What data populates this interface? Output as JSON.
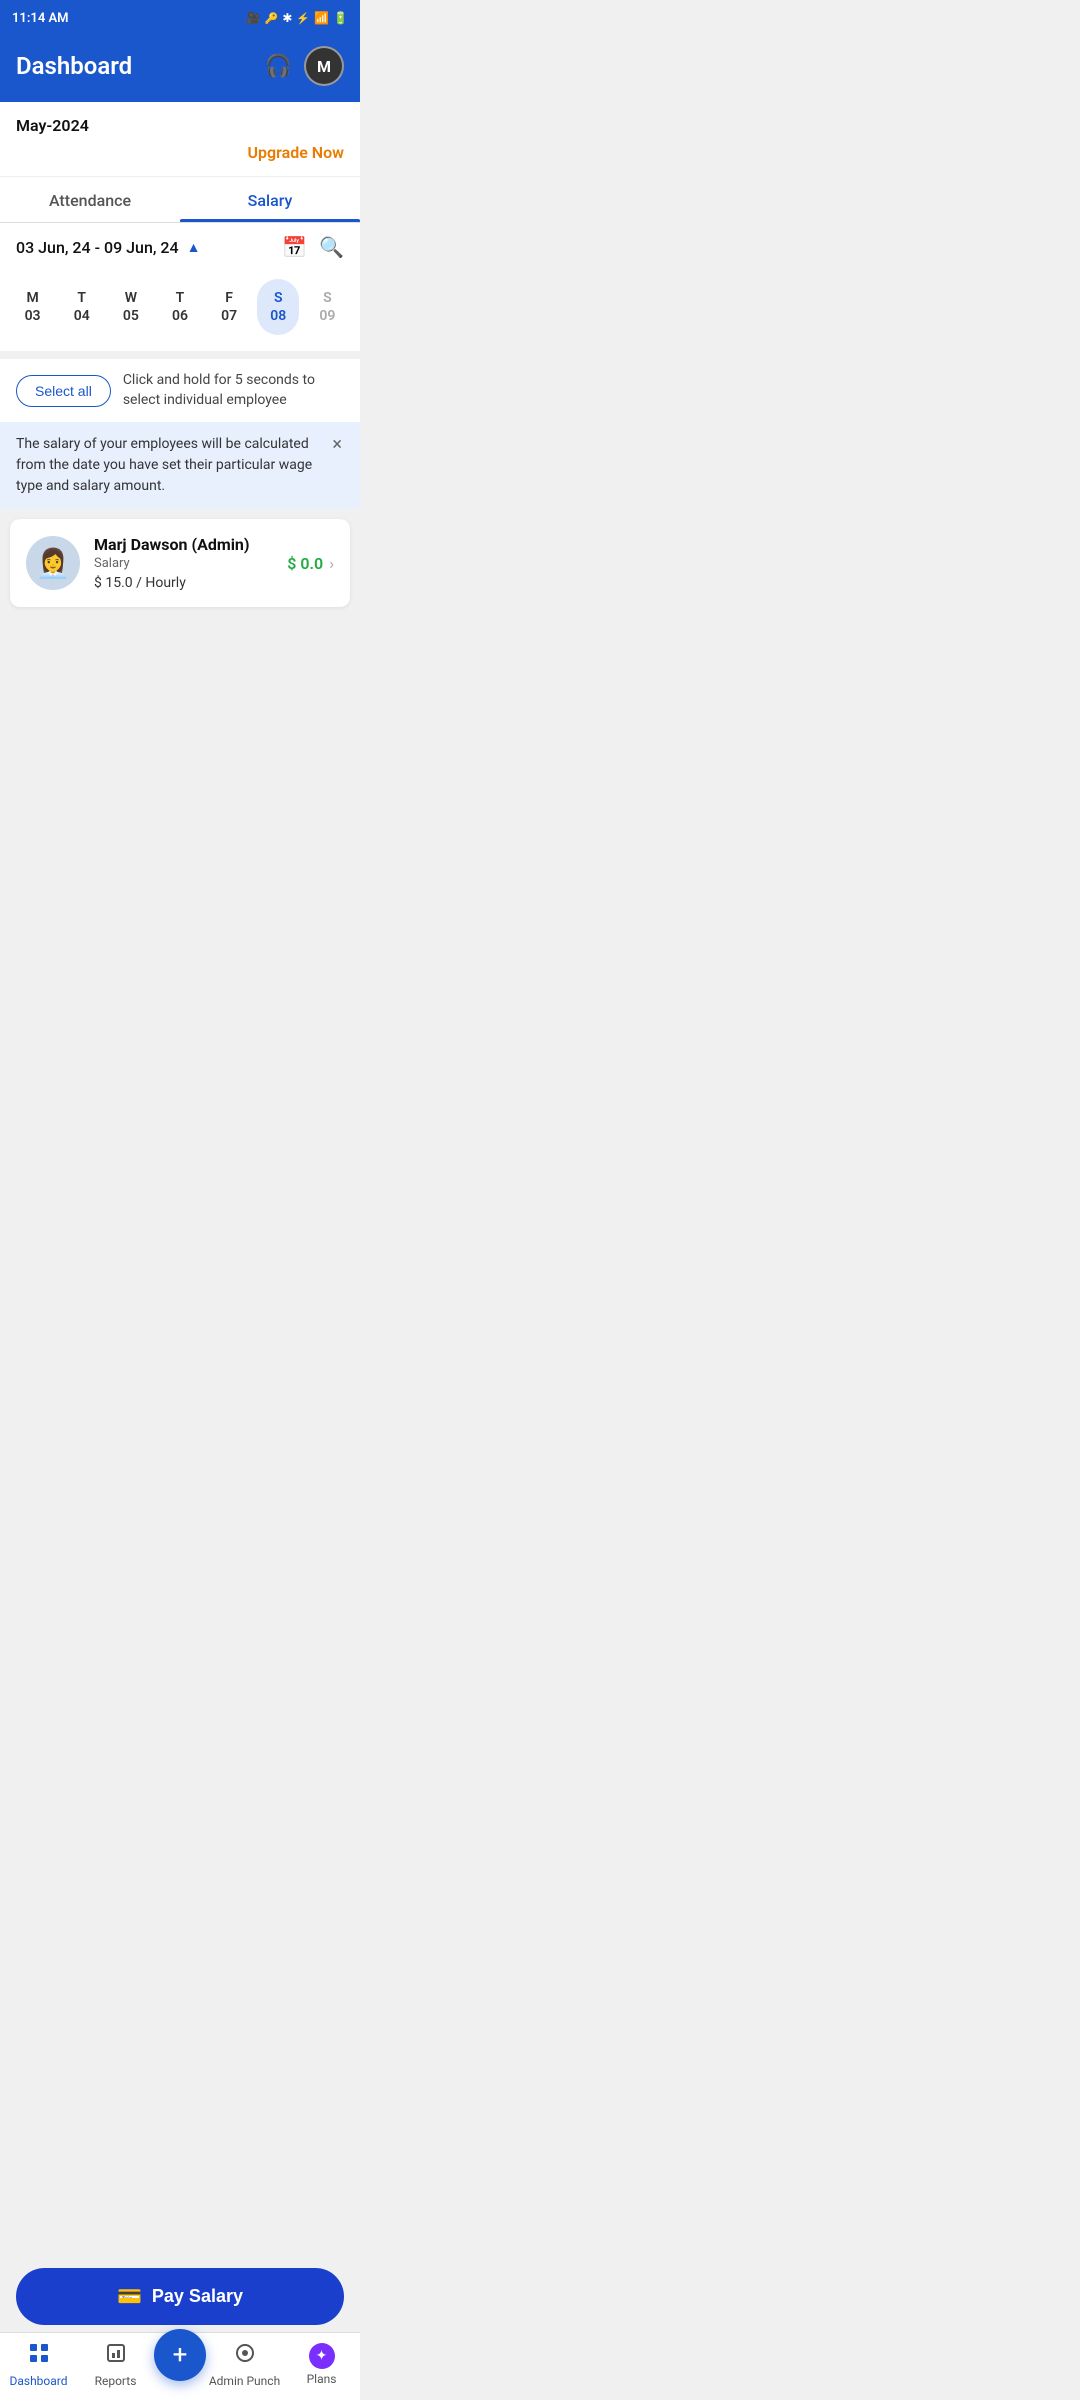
{
  "statusBar": {
    "time": "11:14 AM",
    "icons": [
      "battery-icon",
      "wifi-icon",
      "signal-icon",
      "bluetooth-icon",
      "nfc-icon",
      "record-icon",
      "key-icon",
      "camera-icon",
      "screen-icon"
    ]
  },
  "header": {
    "title": "Dashboard",
    "headset_label": "support",
    "avatar_letter": "M"
  },
  "banner": {
    "month": "May-2024",
    "upgrade_label": "Upgrade Now"
  },
  "tabs": [
    {
      "id": "attendance",
      "label": "Attendance",
      "active": false
    },
    {
      "id": "salary",
      "label": "Salary",
      "active": true
    }
  ],
  "dateRange": {
    "text": "03 Jun, 24 - 09 Jun, 24",
    "chevron": "▲"
  },
  "days": [
    {
      "letter": "M",
      "num": "03",
      "selected": false,
      "muted": false
    },
    {
      "letter": "T",
      "num": "04",
      "selected": false,
      "muted": false
    },
    {
      "letter": "W",
      "num": "05",
      "selected": false,
      "muted": false
    },
    {
      "letter": "T",
      "num": "06",
      "selected": false,
      "muted": false
    },
    {
      "letter": "F",
      "num": "07",
      "selected": false,
      "muted": false
    },
    {
      "letter": "S",
      "num": "08",
      "selected": true,
      "muted": false
    },
    {
      "letter": "S",
      "num": "09",
      "selected": false,
      "muted": true
    }
  ],
  "selectAll": {
    "button_label": "Select all",
    "hint": "Click and hold for 5 seconds to select individual employee"
  },
  "infoBanner": {
    "text": "The salary of your employees will be calculated from the date you have set their particular wage type and salary amount.",
    "close_label": "×"
  },
  "employees": [
    {
      "name": "Marj Dawson (Admin)",
      "type": "Salary",
      "rate": "$ 15.0 / Hourly",
      "salary": "$ 0.0"
    }
  ],
  "paySalaryButton": {
    "label": "Pay Salary"
  },
  "bottomNav": [
    {
      "id": "dashboard",
      "label": "Dashboard",
      "icon": "⊞",
      "active": true
    },
    {
      "id": "reports",
      "label": "Reports",
      "icon": "📊",
      "active": false
    },
    {
      "id": "fab",
      "label": "+",
      "active": false
    },
    {
      "id": "admin-punch",
      "label": "Admin Punch",
      "icon": "◎",
      "active": false
    },
    {
      "id": "plans",
      "label": "Plans",
      "icon": "✦",
      "active": false
    }
  ]
}
